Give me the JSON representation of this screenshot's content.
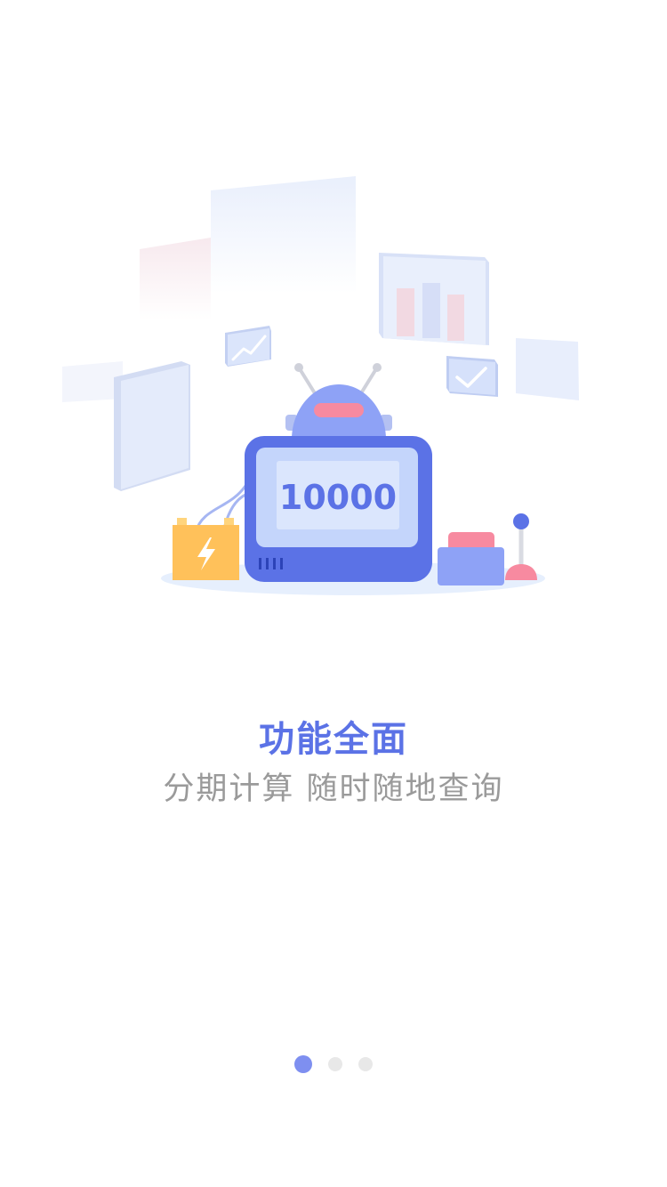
{
  "illustration": {
    "counter_value": "10000",
    "colors": {
      "primary": "#5b72e6",
      "robot_head": "#8ea2f6",
      "screen": "#c4d5fb",
      "battery": "#ffc15a",
      "pink": "#f78aa0",
      "platform": "#e6effd"
    }
  },
  "feature": {
    "title": "功能全面",
    "subtitle": "分期计算 随时随地查询"
  },
  "pager": {
    "total_pages": 3,
    "current_page": 1
  }
}
